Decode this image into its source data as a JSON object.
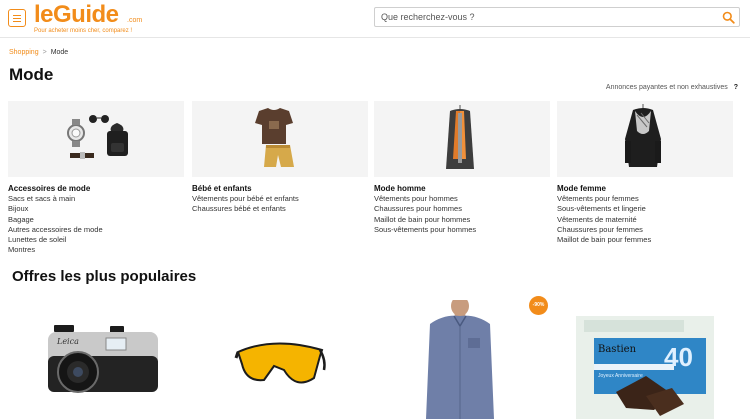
{
  "header": {
    "logo_text": "leGuide",
    "logo_domain": ".com",
    "tagline": "Pour acheter moins cher, comparez !",
    "search_placeholder": "Que recherchez-vous ?"
  },
  "breadcrumb": {
    "home": "Shopping",
    "separator": ">",
    "current": "Mode"
  },
  "page": {
    "title": "Mode",
    "ads_note": "Annonces payantes et non exhaustives",
    "help": "?"
  },
  "categories": [
    {
      "title": "Accessoires de mode",
      "items": [
        "Sacs et sacs à main",
        "Bijoux",
        "Bagage",
        "Autres accessoires de mode",
        "Lunettes de soleil",
        "Montres"
      ]
    },
    {
      "title": "Bébé et enfants",
      "items": [
        "Vêtements pour bébé et enfants",
        "Chaussures bébé et enfants"
      ]
    },
    {
      "title": "Mode homme",
      "items": [
        "Vêtements pour hommes",
        "Chaussures pour hommes",
        "Maillot de bain pour hommes",
        "Sous-vêtements pour hommes"
      ]
    },
    {
      "title": "Mode femme",
      "items": [
        "Vêtements pour femmes",
        "Sous-vêtements et lingerie",
        "Vêtements de maternité",
        "Chaussures pour femmes",
        "Maillot de bain pour femmes"
      ]
    }
  ],
  "offers": {
    "title": "Offres les plus populaires",
    "discount_badge": "-90%",
    "camera_brand": "Leica",
    "card_name": "Bastien",
    "card_number": "40",
    "card_text": "Joyeux Anniversaire"
  },
  "colors": {
    "accent": "#f28c1a",
    "tile_bg": "#f4f4f4"
  }
}
